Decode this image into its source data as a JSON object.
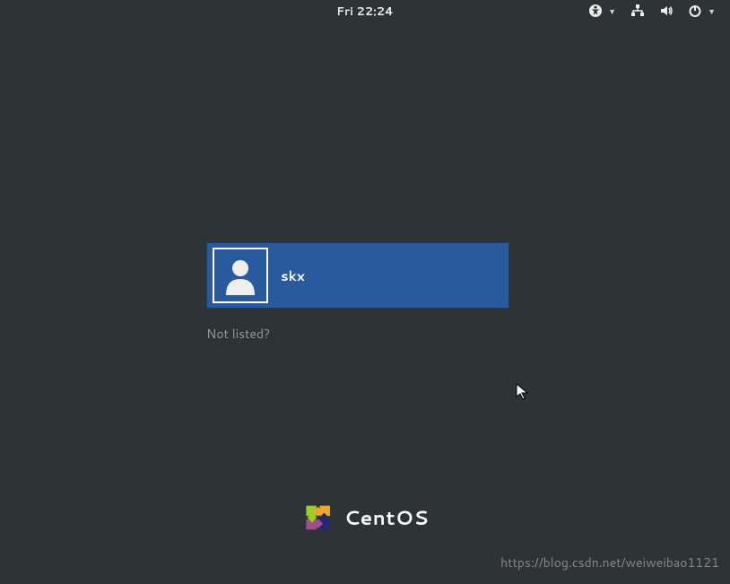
{
  "topbar": {
    "clock": "Fri 22:24"
  },
  "login": {
    "users": [
      {
        "name": "skx"
      }
    ],
    "not_listed_label": "Not listed?"
  },
  "brand": {
    "name": "CentOS"
  },
  "watermark": "https://blog.csdn.net/weiweibao1121"
}
